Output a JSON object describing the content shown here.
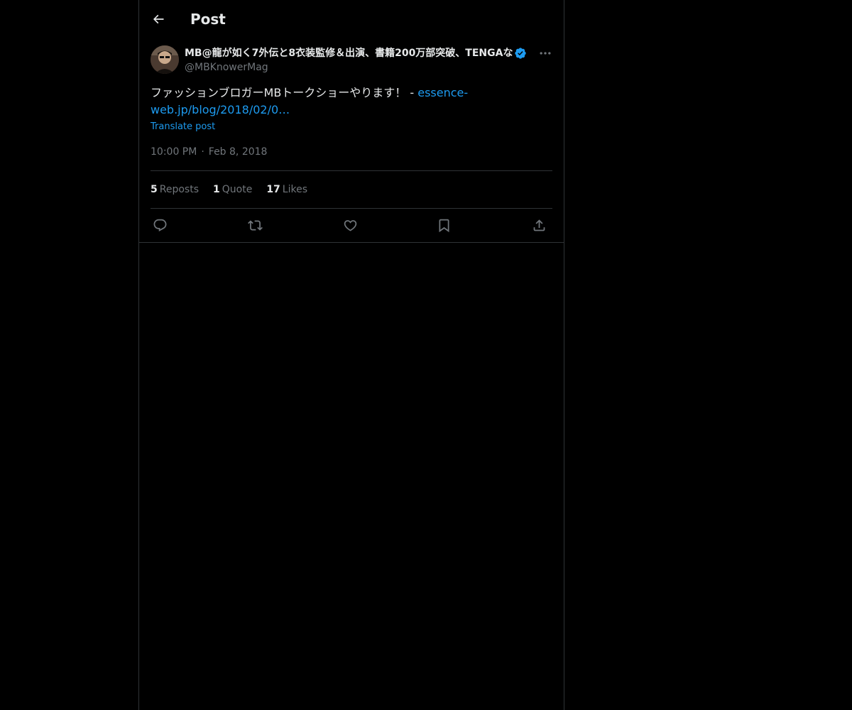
{
  "header": {
    "title": "Post"
  },
  "post": {
    "author_name": "MB@龍が如く7外伝と8衣装監修＆出演、書籍200万部突破、TENGAな",
    "handle": "@MBKnowerMag",
    "text": "ファッションブロガーMBトークショーやります！ - ",
    "link_text_line1": "essence-",
    "link_text_line2": "web.jp/blog/2018/02/0…",
    "translate_label": "Translate post",
    "time": "10:00 PM",
    "separator": "·",
    "date": "Feb 8, 2018"
  },
  "stats": {
    "reposts_count": "5",
    "reposts_label": "Reposts",
    "quotes_count": "1",
    "quotes_label": "Quote",
    "likes_count": "17",
    "likes_label": "Likes"
  },
  "icons": {
    "back": "arrow-left-icon",
    "verified": "verified-badge-icon",
    "more": "more-horizontal-icon",
    "reply": "reply-icon",
    "repost": "repost-icon",
    "like": "heart-icon",
    "bookmark": "bookmark-icon",
    "share": "share-icon"
  },
  "colors": {
    "background": "#000000",
    "text": "#e7e9ea",
    "muted": "#71767b",
    "accent": "#1d9bf0",
    "border": "#2f3336"
  }
}
